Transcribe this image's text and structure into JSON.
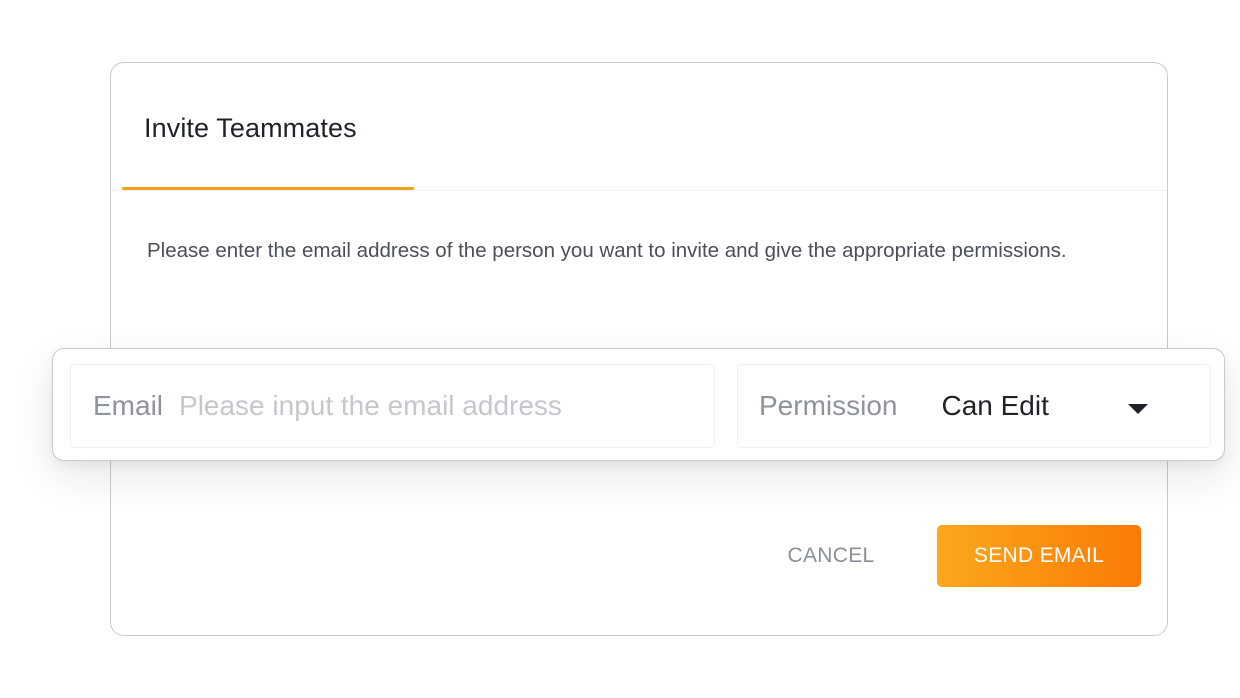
{
  "dialog": {
    "title": "Invite Teammates",
    "description": "Please enter the email address of the person you want to invite and give the appropriate permissions."
  },
  "form": {
    "email_label": "Email",
    "email_placeholder": "Please input the email address",
    "email_value": "",
    "permission_label": "Permission",
    "permission_value": "Can Edit"
  },
  "actions": {
    "cancel_label": "CANCEL",
    "send_label": "SEND EMAIL"
  },
  "colors": {
    "accent": "#f5a01a",
    "button_gradient_start": "#fba81c",
    "button_gradient_end": "#fb7a06"
  },
  "icons": {
    "permission_dropdown": "caret-down-icon"
  }
}
